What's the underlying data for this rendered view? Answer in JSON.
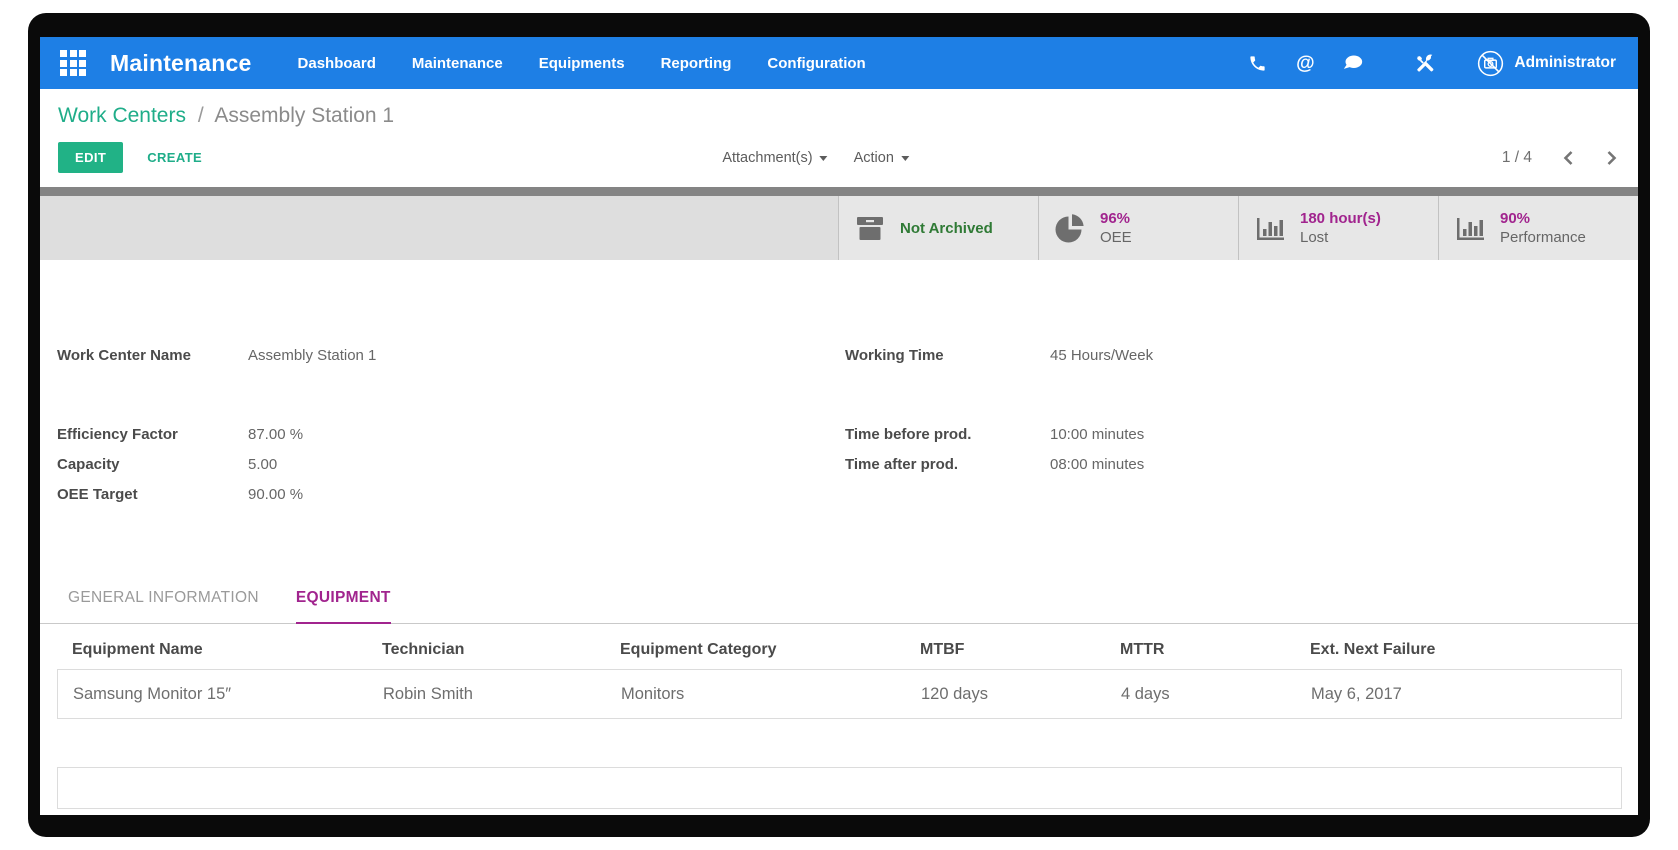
{
  "navbar": {
    "app_title": "Maintenance",
    "menu_items": [
      {
        "label": "Dashboard"
      },
      {
        "label": "Maintenance"
      },
      {
        "label": "Equipments"
      },
      {
        "label": "Reporting"
      },
      {
        "label": "Configuration"
      }
    ],
    "at_symbol": "@",
    "user_name": "Administrator"
  },
  "control_panel": {
    "breadcrumb": {
      "parent": "Work Centers",
      "separator": "/",
      "current": "Assembly Station 1"
    },
    "edit_label": "EDIT",
    "create_label": "CREATE",
    "attachments_label": "Attachment(s)",
    "action_label": "Action",
    "pager": "1 / 4"
  },
  "stat_buttons": [
    {
      "text": "Not Archived"
    },
    {
      "value": "96%",
      "label": "OEE"
    },
    {
      "value": "180 hour(s)",
      "label": "Lost"
    },
    {
      "value": "90%",
      "label": "Performance"
    }
  ],
  "form": {
    "left_fields": [
      {
        "label": "Work Center Name",
        "value": "Assembly Station 1"
      },
      {
        "label": "Efficiency Factor",
        "value": "87.00 %"
      },
      {
        "label": "Capacity",
        "value": "5.00"
      },
      {
        "label": "OEE Target",
        "value": "90.00 %"
      }
    ],
    "right_fields": [
      {
        "label": "Working Time",
        "value": "45 Hours/Week"
      },
      {
        "label": "Time before prod.",
        "value": "10:00 minutes"
      },
      {
        "label": "Time after prod.",
        "value": "08:00 minutes"
      }
    ]
  },
  "tabs": [
    {
      "label": "GENERAL INFORMATION",
      "active": false
    },
    {
      "label": "EQUIPMENT",
      "active": true
    }
  ],
  "equipment_table": {
    "headers": [
      "Equipment Name",
      "Technician",
      "Equipment Category",
      "MTBF",
      "MTTR",
      "Ext. Next Failure"
    ],
    "rows": [
      {
        "name": "Samsung Monitor 15″",
        "technician": "Robin Smith",
        "category": "Monitors",
        "mtbf": "120 days",
        "mttr": "4 days",
        "next_failure": "May 6, 2017"
      }
    ]
  },
  "colors": {
    "navbar_blue": "#1E7FE5",
    "teal_accent": "#1FAD89",
    "magenta_accent": "#A1248E",
    "archived_green": "#2F7A35"
  }
}
